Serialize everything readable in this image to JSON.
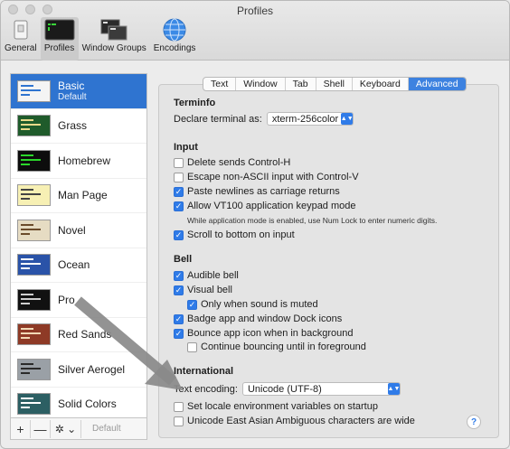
{
  "window": {
    "title": "Profiles"
  },
  "toolbar": {
    "items": [
      {
        "label": "General",
        "icon": "general-icon"
      },
      {
        "label": "Profiles",
        "icon": "profiles-icon",
        "active": true
      },
      {
        "label": "Window Groups",
        "icon": "window-groups-icon"
      },
      {
        "label": "Encodings",
        "icon": "globe-icon"
      }
    ]
  },
  "sidebar": {
    "profiles": [
      {
        "name": "Basic",
        "sub": "Default",
        "selected": true,
        "bg": "#f4f4f4",
        "line": "#2f74d0"
      },
      {
        "name": "Grass",
        "bg": "#1f5b2b",
        "line": "#e9d98a"
      },
      {
        "name": "Homebrew",
        "bg": "#0d0d0d",
        "line": "#2bd62b"
      },
      {
        "name": "Man Page",
        "bg": "#f7f0b4",
        "line": "#444444"
      },
      {
        "name": "Novel",
        "bg": "#e6dcc3",
        "line": "#6b4b2a"
      },
      {
        "name": "Ocean",
        "bg": "#2a53a8",
        "line": "#ffffff"
      },
      {
        "name": "Pro",
        "bg": "#111111",
        "line": "#cfcfcf"
      },
      {
        "name": "Red Sands",
        "bg": "#8e3a26",
        "line": "#f1d9b6"
      },
      {
        "name": "Silver Aerogel",
        "bg": "#9aa0a6",
        "line": "#2a2a2a"
      },
      {
        "name": "Solid Colors",
        "bg": "#2c5f63",
        "line": "#ffffff"
      }
    ],
    "footer": {
      "add": "+",
      "remove": "—",
      "gear": "✲ ⌄",
      "default_label": "Default"
    }
  },
  "tabs": [
    {
      "label": "Text"
    },
    {
      "label": "Window"
    },
    {
      "label": "Tab"
    },
    {
      "label": "Shell"
    },
    {
      "label": "Keyboard"
    },
    {
      "label": "Advanced",
      "active": true
    }
  ],
  "terminfo": {
    "heading": "Terminfo",
    "declare_label": "Declare terminal as:",
    "declare_value": "xterm-256color"
  },
  "input": {
    "heading": "Input",
    "options": [
      {
        "label": "Delete sends Control-H",
        "checked": false
      },
      {
        "label": "Escape non-ASCII input with Control-V",
        "checked": false
      },
      {
        "label": "Paste newlines as carriage returns",
        "checked": true
      },
      {
        "label": "Allow VT100 application keypad mode",
        "checked": true
      }
    ],
    "note": "While application mode is enabled, use Num Lock to enter numeric digits.",
    "scroll": {
      "label": "Scroll to bottom on input",
      "checked": true
    }
  },
  "bell": {
    "heading": "Bell",
    "audible": {
      "label": "Audible bell",
      "checked": true
    },
    "visual": {
      "label": "Visual bell",
      "checked": true
    },
    "muted": {
      "label": "Only when sound is muted",
      "checked": true
    },
    "badge": {
      "label": "Badge app and window Dock icons",
      "checked": true
    },
    "bounce": {
      "label": "Bounce app icon when in background",
      "checked": true
    },
    "continue": {
      "label": "Continue bouncing until in foreground",
      "checked": false
    }
  },
  "international": {
    "heading": "International",
    "encoding_label": "Text encoding:",
    "encoding_value": "Unicode (UTF-8)",
    "locale": {
      "label": "Set locale environment variables on startup",
      "checked": false
    },
    "ambiguous": {
      "label": "Unicode East Asian Ambiguous characters are wide",
      "checked": false
    }
  },
  "help": "?"
}
